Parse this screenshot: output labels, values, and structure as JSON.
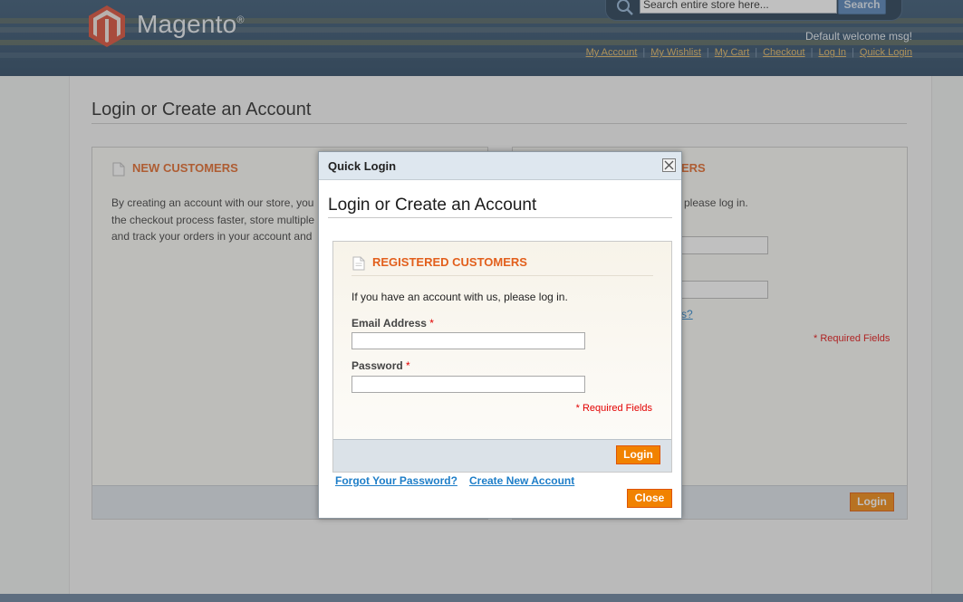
{
  "header": {
    "logo_text": "Magento",
    "logo_reg": "®",
    "search": {
      "placeholder": "Search entire store here...",
      "button": "Search"
    },
    "welcome": "Default welcome msg!",
    "links": [
      "My Account",
      "My Wishlist",
      "My Cart",
      "Checkout",
      "Log In",
      "Quick Login"
    ]
  },
  "page": {
    "title": "Login or Create an Account",
    "new_customers": {
      "heading": "NEW CUSTOMERS",
      "text_lines": [
        "By creating an account with our store, you",
        "the checkout process faster, store multiple",
        "and track your orders in your account and"
      ]
    },
    "registered_partial": {
      "heading_fragment": "ERS",
      "intro_fragment": "please log in.",
      "forgot_fragment": "s?",
      "required": "* Required Fields",
      "login_button": "Login"
    }
  },
  "modal": {
    "title": "Quick Login",
    "page_title": "Login or Create an Account",
    "registered": {
      "heading": "REGISTERED CUSTOMERS",
      "intro": "If you have an account with us, please log in.",
      "email_label": "Email Address",
      "password_label": "Password",
      "required_marker": "*",
      "required_note": "* Required Fields",
      "login_button": "Login"
    },
    "forgot_link": "Forgot Your Password?",
    "create_link": "Create New Account",
    "close_button": "Close"
  },
  "colors": {
    "header_bg": "#1f3d5a",
    "accent_orange": "#f18200",
    "heading_orange": "#e25f1c",
    "link_blue": "#1e7ec8",
    "required_red": "#e30000"
  }
}
